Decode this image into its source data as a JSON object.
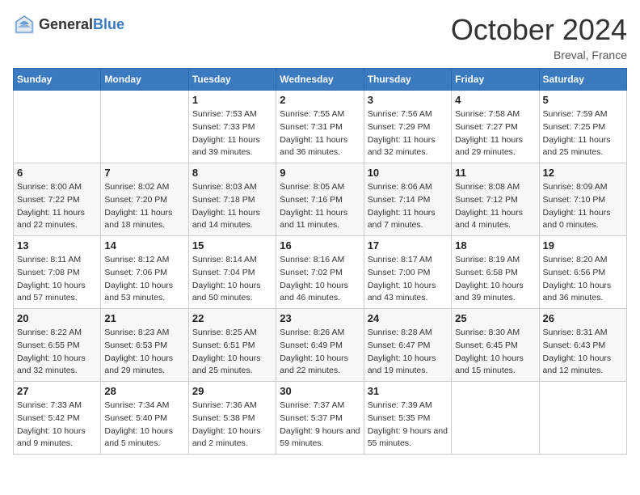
{
  "header": {
    "logo_general": "General",
    "logo_blue": "Blue",
    "month_title": "October 2024",
    "location": "Breval, France"
  },
  "weekdays": [
    "Sunday",
    "Monday",
    "Tuesday",
    "Wednesday",
    "Thursday",
    "Friday",
    "Saturday"
  ],
  "weeks": [
    [
      {
        "day": "",
        "sunrise": "",
        "sunset": "",
        "daylight": ""
      },
      {
        "day": "",
        "sunrise": "",
        "sunset": "",
        "daylight": ""
      },
      {
        "day": "1",
        "sunrise": "Sunrise: 7:53 AM",
        "sunset": "Sunset: 7:33 PM",
        "daylight": "Daylight: 11 hours and 39 minutes."
      },
      {
        "day": "2",
        "sunrise": "Sunrise: 7:55 AM",
        "sunset": "Sunset: 7:31 PM",
        "daylight": "Daylight: 11 hours and 36 minutes."
      },
      {
        "day": "3",
        "sunrise": "Sunrise: 7:56 AM",
        "sunset": "Sunset: 7:29 PM",
        "daylight": "Daylight: 11 hours and 32 minutes."
      },
      {
        "day": "4",
        "sunrise": "Sunrise: 7:58 AM",
        "sunset": "Sunset: 7:27 PM",
        "daylight": "Daylight: 11 hours and 29 minutes."
      },
      {
        "day": "5",
        "sunrise": "Sunrise: 7:59 AM",
        "sunset": "Sunset: 7:25 PM",
        "daylight": "Daylight: 11 hours and 25 minutes."
      }
    ],
    [
      {
        "day": "6",
        "sunrise": "Sunrise: 8:00 AM",
        "sunset": "Sunset: 7:22 PM",
        "daylight": "Daylight: 11 hours and 22 minutes."
      },
      {
        "day": "7",
        "sunrise": "Sunrise: 8:02 AM",
        "sunset": "Sunset: 7:20 PM",
        "daylight": "Daylight: 11 hours and 18 minutes."
      },
      {
        "day": "8",
        "sunrise": "Sunrise: 8:03 AM",
        "sunset": "Sunset: 7:18 PM",
        "daylight": "Daylight: 11 hours and 14 minutes."
      },
      {
        "day": "9",
        "sunrise": "Sunrise: 8:05 AM",
        "sunset": "Sunset: 7:16 PM",
        "daylight": "Daylight: 11 hours and 11 minutes."
      },
      {
        "day": "10",
        "sunrise": "Sunrise: 8:06 AM",
        "sunset": "Sunset: 7:14 PM",
        "daylight": "Daylight: 11 hours and 7 minutes."
      },
      {
        "day": "11",
        "sunrise": "Sunrise: 8:08 AM",
        "sunset": "Sunset: 7:12 PM",
        "daylight": "Daylight: 11 hours and 4 minutes."
      },
      {
        "day": "12",
        "sunrise": "Sunrise: 8:09 AM",
        "sunset": "Sunset: 7:10 PM",
        "daylight": "Daylight: 11 hours and 0 minutes."
      }
    ],
    [
      {
        "day": "13",
        "sunrise": "Sunrise: 8:11 AM",
        "sunset": "Sunset: 7:08 PM",
        "daylight": "Daylight: 10 hours and 57 minutes."
      },
      {
        "day": "14",
        "sunrise": "Sunrise: 8:12 AM",
        "sunset": "Sunset: 7:06 PM",
        "daylight": "Daylight: 10 hours and 53 minutes."
      },
      {
        "day": "15",
        "sunrise": "Sunrise: 8:14 AM",
        "sunset": "Sunset: 7:04 PM",
        "daylight": "Daylight: 10 hours and 50 minutes."
      },
      {
        "day": "16",
        "sunrise": "Sunrise: 8:16 AM",
        "sunset": "Sunset: 7:02 PM",
        "daylight": "Daylight: 10 hours and 46 minutes."
      },
      {
        "day": "17",
        "sunrise": "Sunrise: 8:17 AM",
        "sunset": "Sunset: 7:00 PM",
        "daylight": "Daylight: 10 hours and 43 minutes."
      },
      {
        "day": "18",
        "sunrise": "Sunrise: 8:19 AM",
        "sunset": "Sunset: 6:58 PM",
        "daylight": "Daylight: 10 hours and 39 minutes."
      },
      {
        "day": "19",
        "sunrise": "Sunrise: 8:20 AM",
        "sunset": "Sunset: 6:56 PM",
        "daylight": "Daylight: 10 hours and 36 minutes."
      }
    ],
    [
      {
        "day": "20",
        "sunrise": "Sunrise: 8:22 AM",
        "sunset": "Sunset: 6:55 PM",
        "daylight": "Daylight: 10 hours and 32 minutes."
      },
      {
        "day": "21",
        "sunrise": "Sunrise: 8:23 AM",
        "sunset": "Sunset: 6:53 PM",
        "daylight": "Daylight: 10 hours and 29 minutes."
      },
      {
        "day": "22",
        "sunrise": "Sunrise: 8:25 AM",
        "sunset": "Sunset: 6:51 PM",
        "daylight": "Daylight: 10 hours and 25 minutes."
      },
      {
        "day": "23",
        "sunrise": "Sunrise: 8:26 AM",
        "sunset": "Sunset: 6:49 PM",
        "daylight": "Daylight: 10 hours and 22 minutes."
      },
      {
        "day": "24",
        "sunrise": "Sunrise: 8:28 AM",
        "sunset": "Sunset: 6:47 PM",
        "daylight": "Daylight: 10 hours and 19 minutes."
      },
      {
        "day": "25",
        "sunrise": "Sunrise: 8:30 AM",
        "sunset": "Sunset: 6:45 PM",
        "daylight": "Daylight: 10 hours and 15 minutes."
      },
      {
        "day": "26",
        "sunrise": "Sunrise: 8:31 AM",
        "sunset": "Sunset: 6:43 PM",
        "daylight": "Daylight: 10 hours and 12 minutes."
      }
    ],
    [
      {
        "day": "27",
        "sunrise": "Sunrise: 7:33 AM",
        "sunset": "Sunset: 5:42 PM",
        "daylight": "Daylight: 10 hours and 9 minutes."
      },
      {
        "day": "28",
        "sunrise": "Sunrise: 7:34 AM",
        "sunset": "Sunset: 5:40 PM",
        "daylight": "Daylight: 10 hours and 5 minutes."
      },
      {
        "day": "29",
        "sunrise": "Sunrise: 7:36 AM",
        "sunset": "Sunset: 5:38 PM",
        "daylight": "Daylight: 10 hours and 2 minutes."
      },
      {
        "day": "30",
        "sunrise": "Sunrise: 7:37 AM",
        "sunset": "Sunset: 5:37 PM",
        "daylight": "Daylight: 9 hours and 59 minutes."
      },
      {
        "day": "31",
        "sunrise": "Sunrise: 7:39 AM",
        "sunset": "Sunset: 5:35 PM",
        "daylight": "Daylight: 9 hours and 55 minutes."
      },
      {
        "day": "",
        "sunrise": "",
        "sunset": "",
        "daylight": ""
      },
      {
        "day": "",
        "sunrise": "",
        "sunset": "",
        "daylight": ""
      }
    ]
  ]
}
